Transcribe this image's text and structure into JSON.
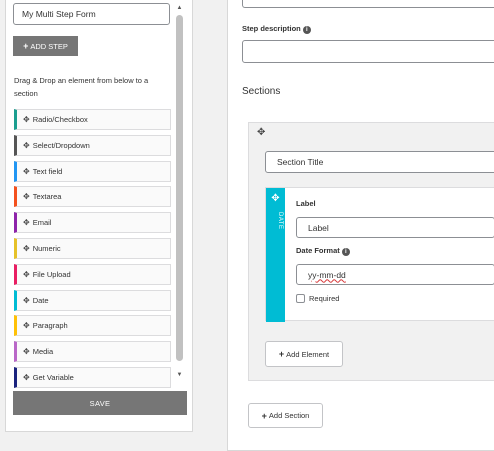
{
  "left": {
    "form_name": "My Multi Step Form",
    "add_step_label": "ADD STEP",
    "drag_help": "Drag & Drop an element from below to a section",
    "elements": [
      {
        "label": "Radio/Checkbox",
        "color": "#1a9e8f"
      },
      {
        "label": "Select/Dropdown",
        "color": "#555555"
      },
      {
        "label": "Text field",
        "color": "#2196f3"
      },
      {
        "label": "Textarea",
        "color": "#f4511e"
      },
      {
        "label": "Email",
        "color": "#8e24aa"
      },
      {
        "label": "Numeric",
        "color": "#e6c229"
      },
      {
        "label": "File Upload",
        "color": "#e91e63"
      },
      {
        "label": "Date",
        "color": "#00bcd4"
      },
      {
        "label": "Paragraph",
        "color": "#ffc107"
      },
      {
        "label": "Media",
        "color": "#ba68c8"
      },
      {
        "label": "Get Variable",
        "color": "#1a237e"
      }
    ],
    "save_label": "SAVE"
  },
  "right": {
    "step_description_label": "Step description",
    "sections_heading": "Sections",
    "section_title_value": "Section Title",
    "field": {
      "type_tag": "DATE",
      "type_color": "#00bcd4",
      "label_caption": "Label",
      "label_value": "Label",
      "date_format_caption": "Date Format",
      "date_format_value": "yy-mm-dd",
      "required_caption": "Required"
    },
    "add_element_label": "Add Element",
    "add_section_label": "Add Section"
  }
}
